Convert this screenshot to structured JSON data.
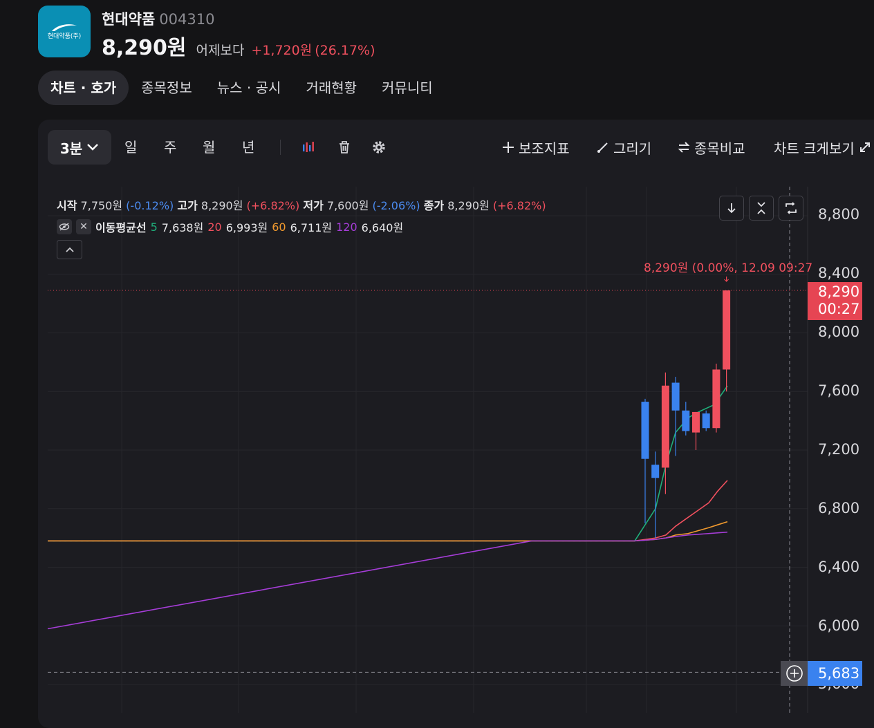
{
  "header": {
    "logo_text": "현대약품(주)",
    "stock_name": "현대약품",
    "stock_code": "004310",
    "price": "8,290원",
    "vs_label": "어제보다",
    "change": "+1,720원",
    "change_pct": "(26.17%)"
  },
  "tabs": [
    {
      "label": "차트 · 호가",
      "active": true
    },
    {
      "label": "종목정보",
      "active": false
    },
    {
      "label": "뉴스 · 공시",
      "active": false
    },
    {
      "label": "거래현황",
      "active": false
    },
    {
      "label": "커뮤니티",
      "active": false
    }
  ],
  "toolbar": {
    "selected_timeframe": "3분",
    "timeframes": [
      "일",
      "주",
      "월",
      "년"
    ],
    "indicator_label": "보조지표",
    "draw_label": "그리기",
    "compare_label": "종목비교",
    "fullscreen_label": "차트 크게보기"
  },
  "ohlc": {
    "open_label": "시작",
    "open": "7,750원",
    "open_pct": "(-0.12%)",
    "high_label": "고가",
    "high": "8,290원",
    "high_pct": "(+6.82%)",
    "low_label": "저가",
    "low": "7,600원",
    "low_pct": "(-2.06%)",
    "close_label": "종가",
    "close": "8,290원",
    "close_pct": "(+6.82%)"
  },
  "ma": {
    "label": "이동평균선",
    "items": [
      {
        "period": "5",
        "value": "7,638원",
        "color": "#1fae7a"
      },
      {
        "period": "20",
        "value": "6,993원",
        "color": "#f0505e"
      },
      {
        "period": "60",
        "value": "6,711원",
        "color": "#f29a2e"
      },
      {
        "period": "120",
        "value": "6,640원",
        "color": "#a63dd8"
      }
    ]
  },
  "last_annotation": "8,290원 (0.00%, 12.09 09:27",
  "current_tag": {
    "price": "8,290",
    "countdown": "00:27"
  },
  "crosshair_tag": {
    "price": "5,683"
  },
  "colors": {
    "up": "#f0505e",
    "down": "#3a82ef",
    "bg": "#1c1c21"
  },
  "chart_data": {
    "type": "candlestick",
    "y_ticks": [
      8800,
      8400,
      8000,
      7600,
      7200,
      6800,
      6400,
      6000,
      5600
    ],
    "y_tick_labels": [
      "8,800",
      "8,400",
      "8,000",
      "7,600",
      "7,200",
      "6,800",
      "6,400",
      "6,000",
      "5,600"
    ],
    "ylim": [
      5600,
      8800
    ],
    "grid": true,
    "candles": [
      {
        "open": 7530,
        "high": 7550,
        "low": 6700,
        "close": 7140
      },
      {
        "open": 7100,
        "high": 7190,
        "low": 6600,
        "close": 7010
      },
      {
        "open": 7080,
        "high": 7730,
        "low": 6900,
        "close": 7640
      },
      {
        "open": 7660,
        "high": 7700,
        "low": 7160,
        "close": 7470
      },
      {
        "open": 7470,
        "high": 7530,
        "low": 7300,
        "close": 7330
      },
      {
        "open": 7320,
        "high": 7460,
        "low": 7200,
        "close": 7460
      },
      {
        "open": 7450,
        "high": 7470,
        "low": 7330,
        "close": 7350
      },
      {
        "open": 7350,
        "high": 7790,
        "low": 7320,
        "close": 7750
      },
      {
        "open": 7750,
        "high": 8290,
        "low": 7600,
        "close": 8290
      }
    ],
    "ma_series": [
      {
        "name": "5",
        "points": [
          6580,
          6580,
          6580,
          6800,
          7100,
          7320,
          7420,
          7460,
          7510,
          7638
        ]
      },
      {
        "name": "20",
        "points": [
          6580,
          6580,
          6580,
          6600,
          6620,
          6680,
          6740,
          6790,
          6840,
          6920,
          6993
        ]
      },
      {
        "name": "60",
        "points": [
          6580,
          6580,
          6580,
          6590,
          6600,
          6620,
          6630,
          6650,
          6670,
          6690,
          6711
        ]
      },
      {
        "name": "120",
        "points": [
          5980,
          6580,
          6580,
          6590,
          6600,
          6610,
          6620,
          6625,
          6640
        ]
      }
    ],
    "flat_level": 6580,
    "last_price": 8290,
    "crosshair_price": 5683
  }
}
